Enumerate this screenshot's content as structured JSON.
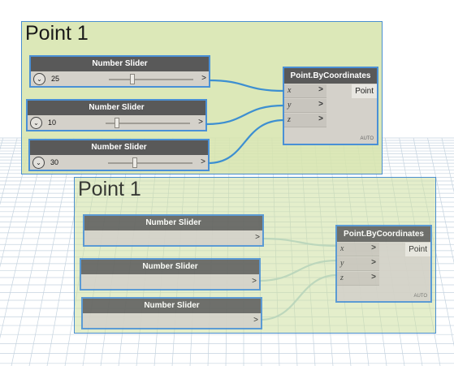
{
  "groups": {
    "top": {
      "title": "Point 1"
    },
    "ghost": {
      "title": "Point 1"
    }
  },
  "top_nodes": {
    "sliders": [
      {
        "title": "Number Slider",
        "value": "25",
        "output": ">",
        "expander_icon": "chevron-down-icon"
      },
      {
        "title": "Number Slider",
        "value": "10",
        "output": ">",
        "expander_icon": "chevron-down-icon"
      },
      {
        "title": "Number Slider",
        "value": "30",
        "output": ">",
        "expander_icon": "chevron-down-icon"
      }
    ],
    "point": {
      "title": "Point.ByCoordinates",
      "inputs": [
        {
          "label": "x",
          "arrow": ">"
        },
        {
          "label": "y",
          "arrow": ">"
        },
        {
          "label": "z",
          "arrow": ">"
        }
      ],
      "output": "Point",
      "lacing": "AUTO"
    }
  },
  "ghost_nodes": {
    "sliders": [
      {
        "title": "Number Slider",
        "output": ">"
      },
      {
        "title": "Number Slider",
        "output": ">"
      },
      {
        "title": "Number Slider",
        "output": ">"
      }
    ],
    "point": {
      "title": "Point.ByCoordinates",
      "inputs": [
        {
          "label": "x",
          "arrow": ">"
        },
        {
          "label": "y",
          "arrow": ">"
        },
        {
          "label": "z",
          "arrow": ">"
        }
      ],
      "output": "Point",
      "lacing": "AUTO"
    }
  },
  "colors": {
    "wire": "#3d8fd1",
    "wire_faded": "#9ec8da",
    "group_fill": "#d6e4ab",
    "node_border": "#4a90d6",
    "header": "#595959",
    "grid": "#c8d6e2"
  }
}
